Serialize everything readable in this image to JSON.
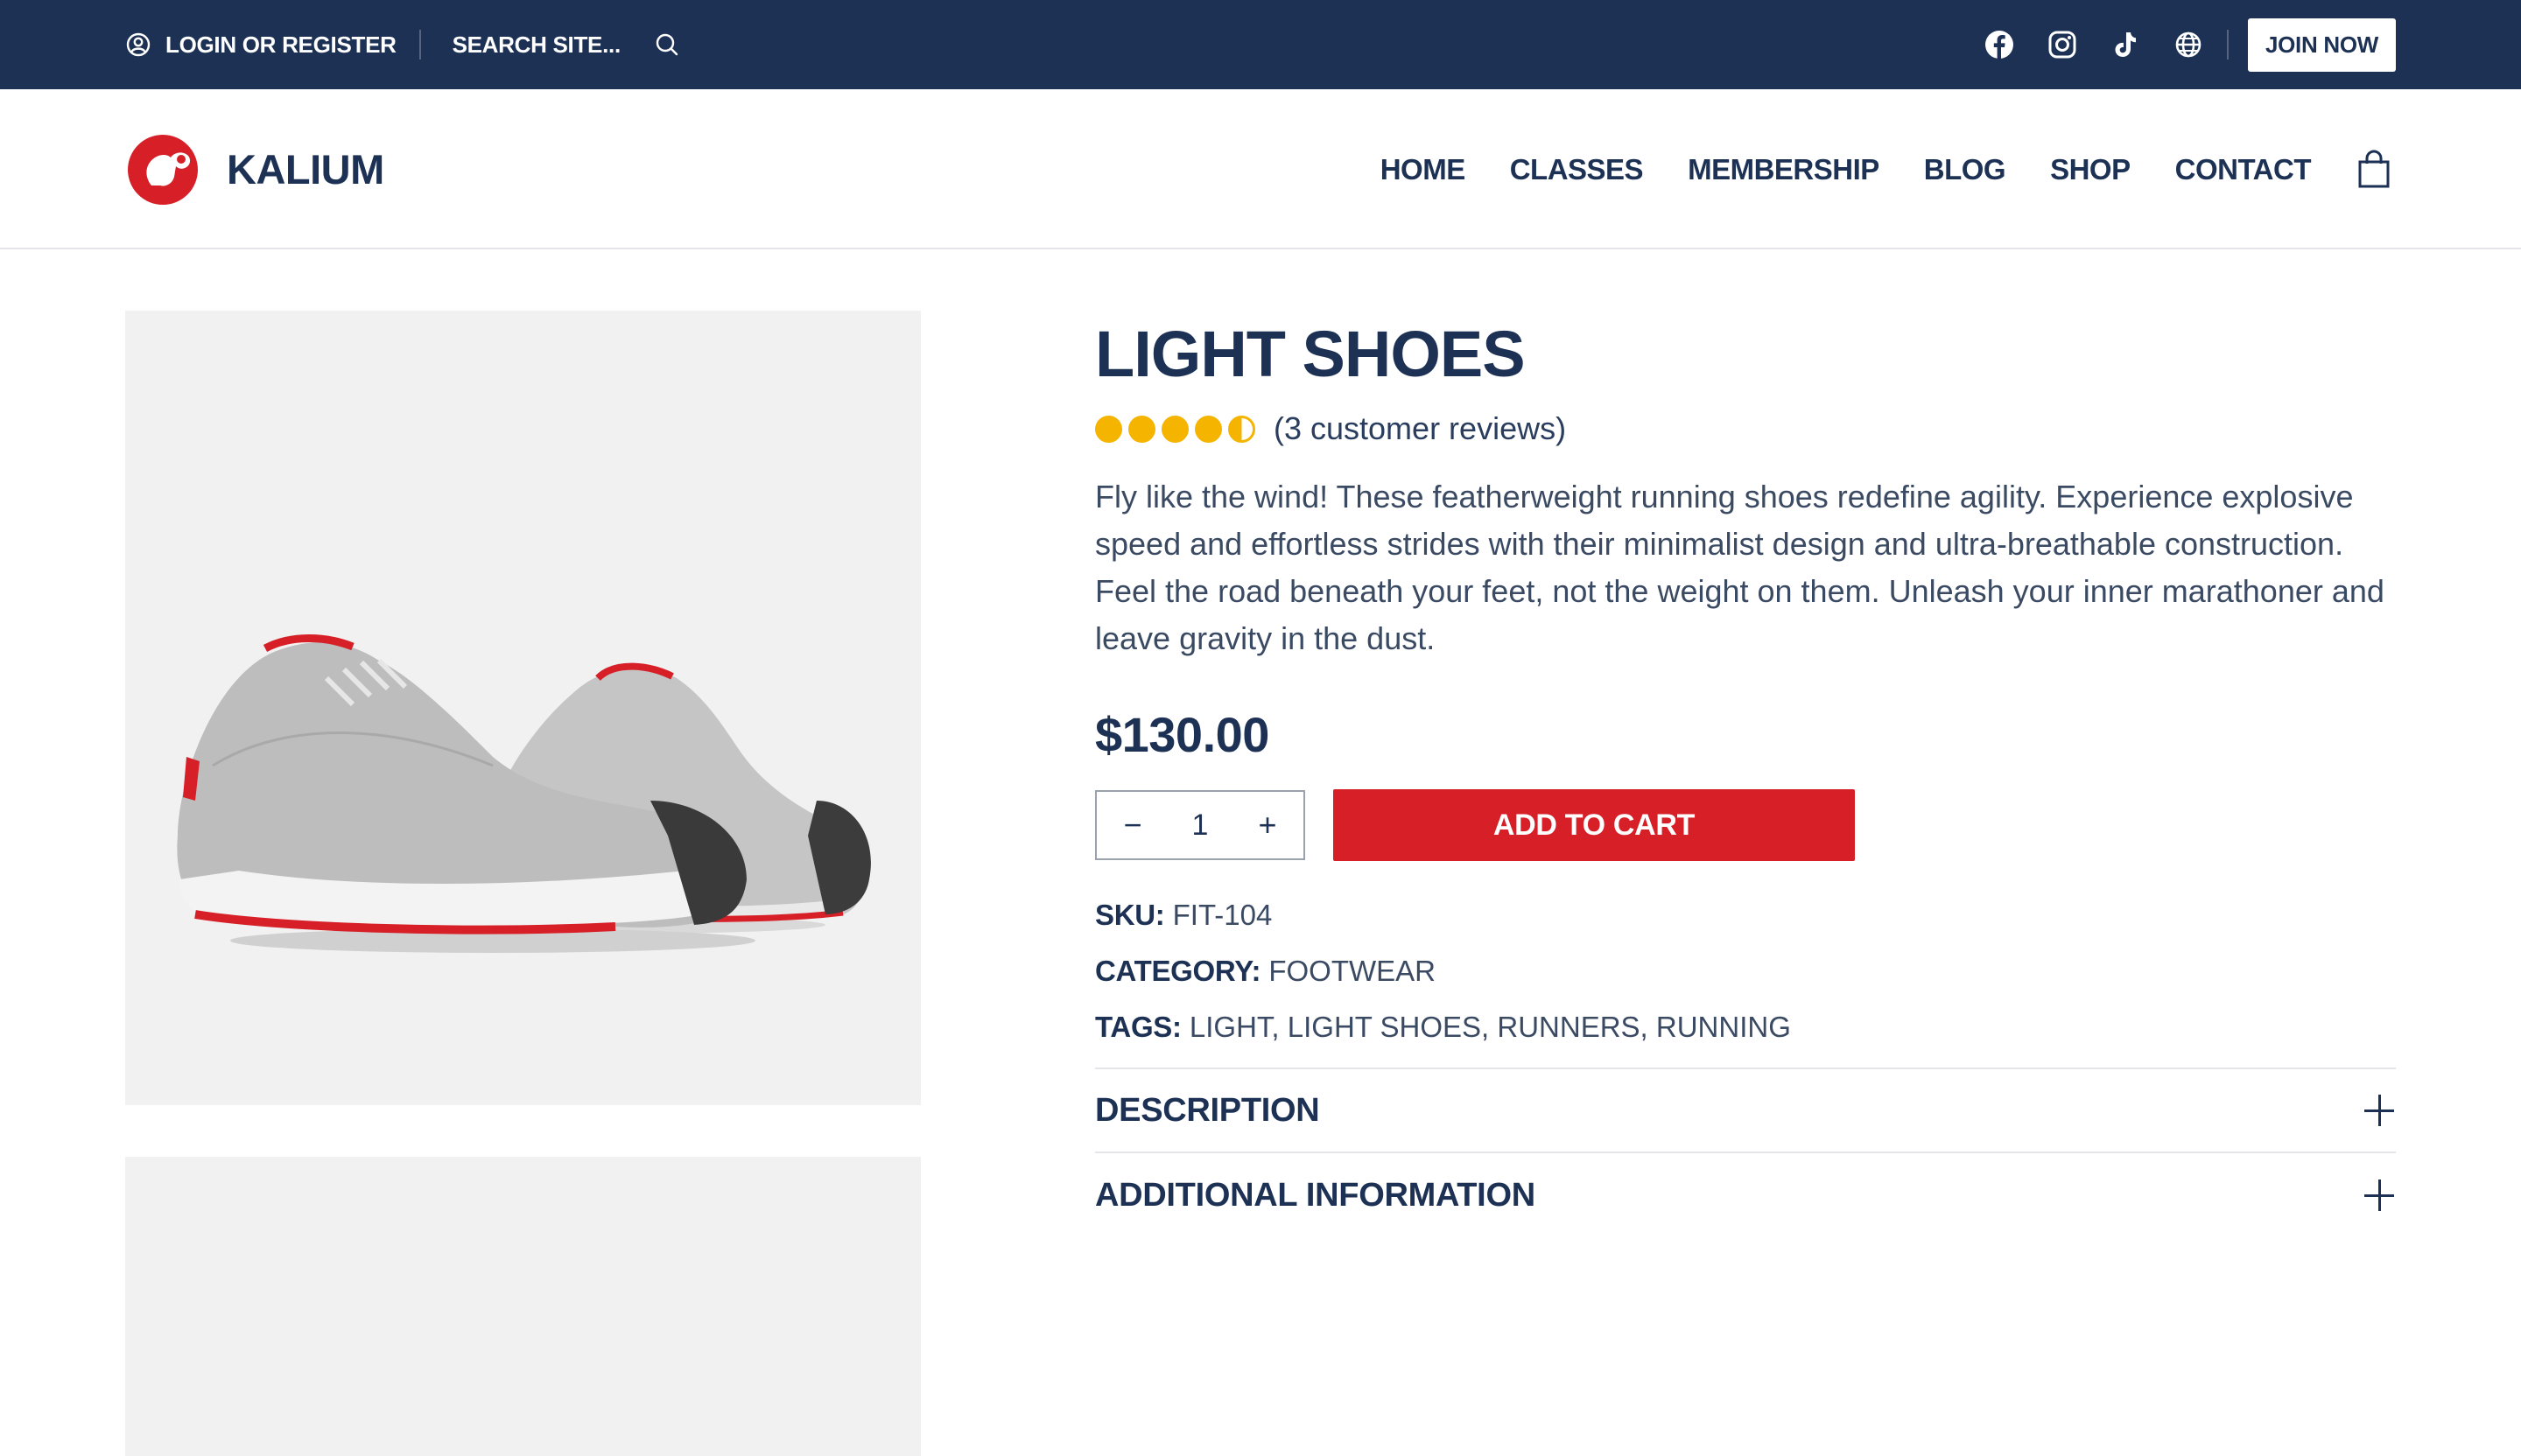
{
  "topbar": {
    "login_label": "LOGIN OR REGISTER",
    "search_placeholder": "SEARCH SITE...",
    "join_label": "JOIN NOW",
    "social_icons": [
      "facebook-icon",
      "instagram-icon",
      "tiktok-icon",
      "globe-icon"
    ],
    "background_color": "#1c3154"
  },
  "header": {
    "logo_text": "KALIUM",
    "nav": [
      "HOME",
      "CLASSES",
      "MEMBERSHIP",
      "BLOG",
      "SHOP",
      "CONTACT"
    ],
    "cart_icon": "shopping-bag-icon"
  },
  "product": {
    "title": "LIGHT SHOES",
    "rating": 4.5,
    "rating_max": 5,
    "reviews_label": "(3 customer reviews)",
    "description": "Fly like the wind! These featherweight running shoes redefine agility. Experience explosive speed and effortless strides with their minimalist design and ultra-breathable construction. Feel the road beneath your feet, not the weight on them. Unleash your inner marathoner and leave gravity in the dust.",
    "price": "$130.00",
    "quantity": "1",
    "add_to_cart_label": "ADD TO CART",
    "sku_label": "SKU:",
    "sku_value": "FIT-104",
    "category_label": "CATEGORY:",
    "category_value": "FOOTWEAR",
    "tags_label": "TAGS:",
    "tags_value": "LIGHT, LIGHT SHOES, RUNNERS, RUNNING",
    "accordion": [
      "DESCRIPTION",
      "ADDITIONAL INFORMATION"
    ],
    "accent_color": "#d71f27",
    "star_color": "#f4b400"
  }
}
